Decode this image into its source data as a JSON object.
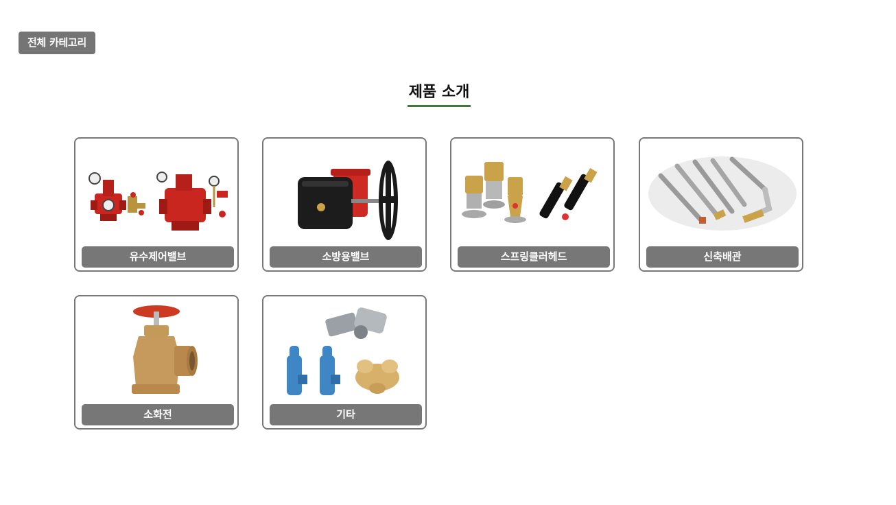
{
  "header": {
    "all_category_label": "전체 카테고리"
  },
  "section": {
    "title": "제품 소개"
  },
  "products": [
    {
      "label": "유수제어밸브",
      "icon": "alarm-valve-icon"
    },
    {
      "label": "소방용밸브",
      "icon": "butterfly-valve-icon"
    },
    {
      "label": "스프링클러헤드",
      "icon": "sprinkler-head-icon"
    },
    {
      "label": "신축배관",
      "icon": "flexible-pipe-icon"
    },
    {
      "label": "소화전",
      "icon": "hydrant-valve-icon"
    },
    {
      "label": "기타",
      "icon": "fittings-icon"
    }
  ],
  "colors": {
    "label_bg": "#777777",
    "title_underline": "#3f7a3a"
  }
}
